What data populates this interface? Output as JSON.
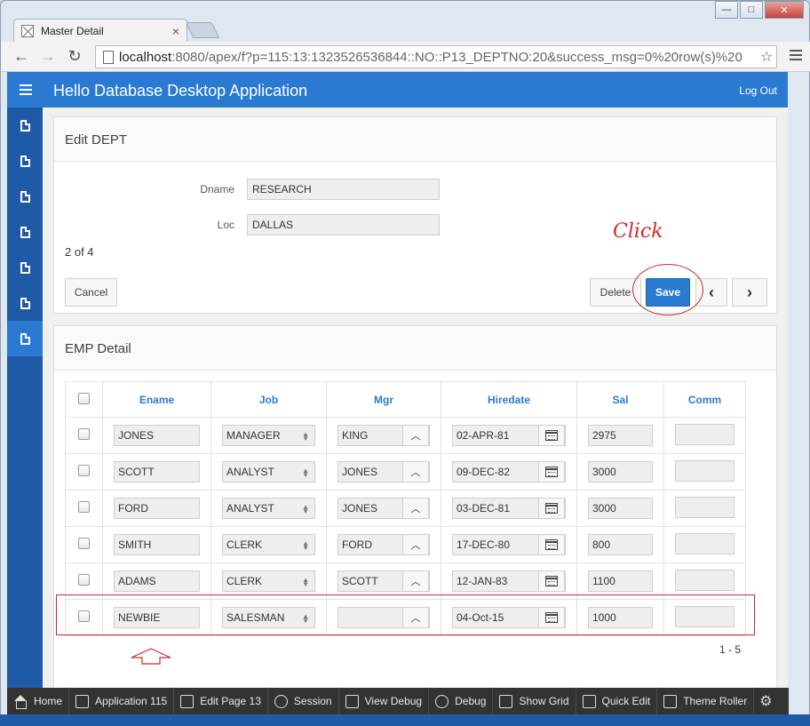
{
  "browser": {
    "tab_title": "Master Detail",
    "tab_close": "×",
    "url_host": "localhost",
    "url_rest": ":8080/apex/f?p=115:13:1323526536844::NO::P13_DEPTNO:20&success_msg=0%20row(s)%20",
    "back": "←",
    "forward": "→",
    "reload": "↻",
    "star": "☆",
    "win_min": "—",
    "win_max": "□",
    "win_close": "✕"
  },
  "app": {
    "title": "Hello Database Desktop Application",
    "logout": "Log Out"
  },
  "form_region": {
    "title": "Edit DEPT",
    "dname_label": "Dname",
    "dname_value": "RESEARCH",
    "loc_label": "Loc",
    "loc_value": "DALLAS",
    "counter": "2 of 4",
    "cancel": "Cancel",
    "delete": "Delete",
    "save": "Save",
    "prev": "‹",
    "next": "›"
  },
  "annotation": {
    "click_text": "Click"
  },
  "detail_region": {
    "title": "EMP Detail",
    "columns": [
      "Ename",
      "Job",
      "Mgr",
      "Hiredate",
      "Sal",
      "Comm"
    ],
    "rows": [
      {
        "ename": "JONES",
        "job": "MANAGER",
        "mgr": "KING",
        "hiredate": "02-APR-81",
        "sal": "2975",
        "comm": ""
      },
      {
        "ename": "SCOTT",
        "job": "ANALYST",
        "mgr": "JONES",
        "hiredate": "09-DEC-82",
        "sal": "3000",
        "comm": ""
      },
      {
        "ename": "FORD",
        "job": "ANALYST",
        "mgr": "JONES",
        "hiredate": "03-DEC-81",
        "sal": "3000",
        "comm": ""
      },
      {
        "ename": "SMITH",
        "job": "CLERK",
        "mgr": "FORD",
        "hiredate": "17-DEC-80",
        "sal": "800",
        "comm": ""
      },
      {
        "ename": "ADAMS",
        "job": "CLERK",
        "mgr": "SCOTT",
        "hiredate": "12-JAN-83",
        "sal": "1100",
        "comm": ""
      },
      {
        "ename": "NEWBIE",
        "job": "SALESMAN",
        "mgr": "",
        "hiredate": "04-Oct-15",
        "sal": "1000",
        "comm": ""
      }
    ],
    "range": "1 - 5"
  },
  "devbar": {
    "items": [
      "Home",
      "Application 115",
      "Edit Page 13",
      "Session",
      "View Debug",
      "Debug",
      "Show Grid",
      "Quick Edit",
      "Theme Roller"
    ]
  },
  "colors": {
    "accent": "#2a7ad2",
    "sidebar": "#1f5aa6",
    "annotation": "#cc2a2a"
  }
}
